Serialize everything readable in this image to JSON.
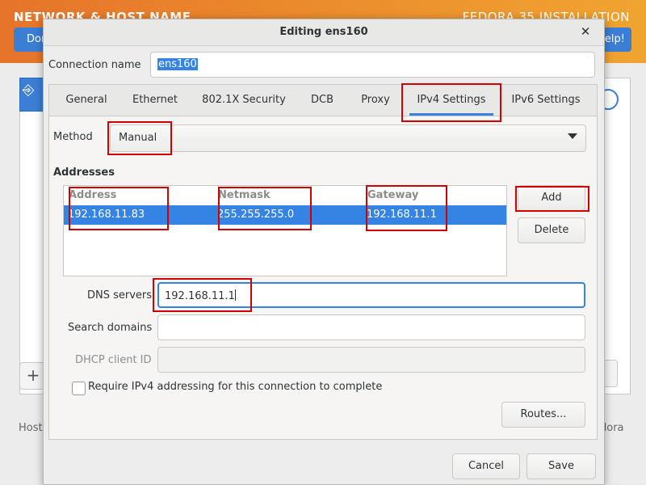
{
  "background": {
    "title": "NETWORK & HOST NAME",
    "right_title": "FEDORA 35 INSTALLATION",
    "done_button": "Done",
    "help_button": "Help!",
    "host_label": "Host",
    "fedora_label": "edora"
  },
  "dialog": {
    "title": "Editing ens160",
    "close_icon": "close-icon",
    "connection_name_label": "Connection name",
    "connection_name_value": "ens160",
    "tabs": [
      "General",
      "Ethernet",
      "802.1X Security",
      "DCB",
      "Proxy",
      "IPv4 Settings",
      "IPv6 Settings"
    ],
    "active_tab": "IPv4 Settings",
    "method_label": "Method",
    "method_value": "Manual",
    "addresses_label": "Addresses",
    "columns": [
      "Address",
      "Netmask",
      "Gateway"
    ],
    "rows": [
      {
        "address": "192.168.11.83",
        "netmask": "255.255.255.0",
        "gateway": "192.168.11.1"
      }
    ],
    "add_button": "Add",
    "delete_button": "Delete",
    "dns_label": "DNS servers",
    "dns_value": "192.168.11.1",
    "search_domains_label": "Search domains",
    "search_domains_value": "",
    "dhcp_client_id_label": "DHCP client ID",
    "dhcp_client_id_value": "",
    "require_ipv4_label": "Require IPv4 addressing for this connection to complete",
    "require_ipv4_checked": false,
    "routes_button": "Routes...",
    "cancel_button": "Cancel",
    "save_button": "Save"
  },
  "colors": {
    "accent": "#3584e4",
    "highlight": "#d40000",
    "header_orange": "#e6742a"
  }
}
